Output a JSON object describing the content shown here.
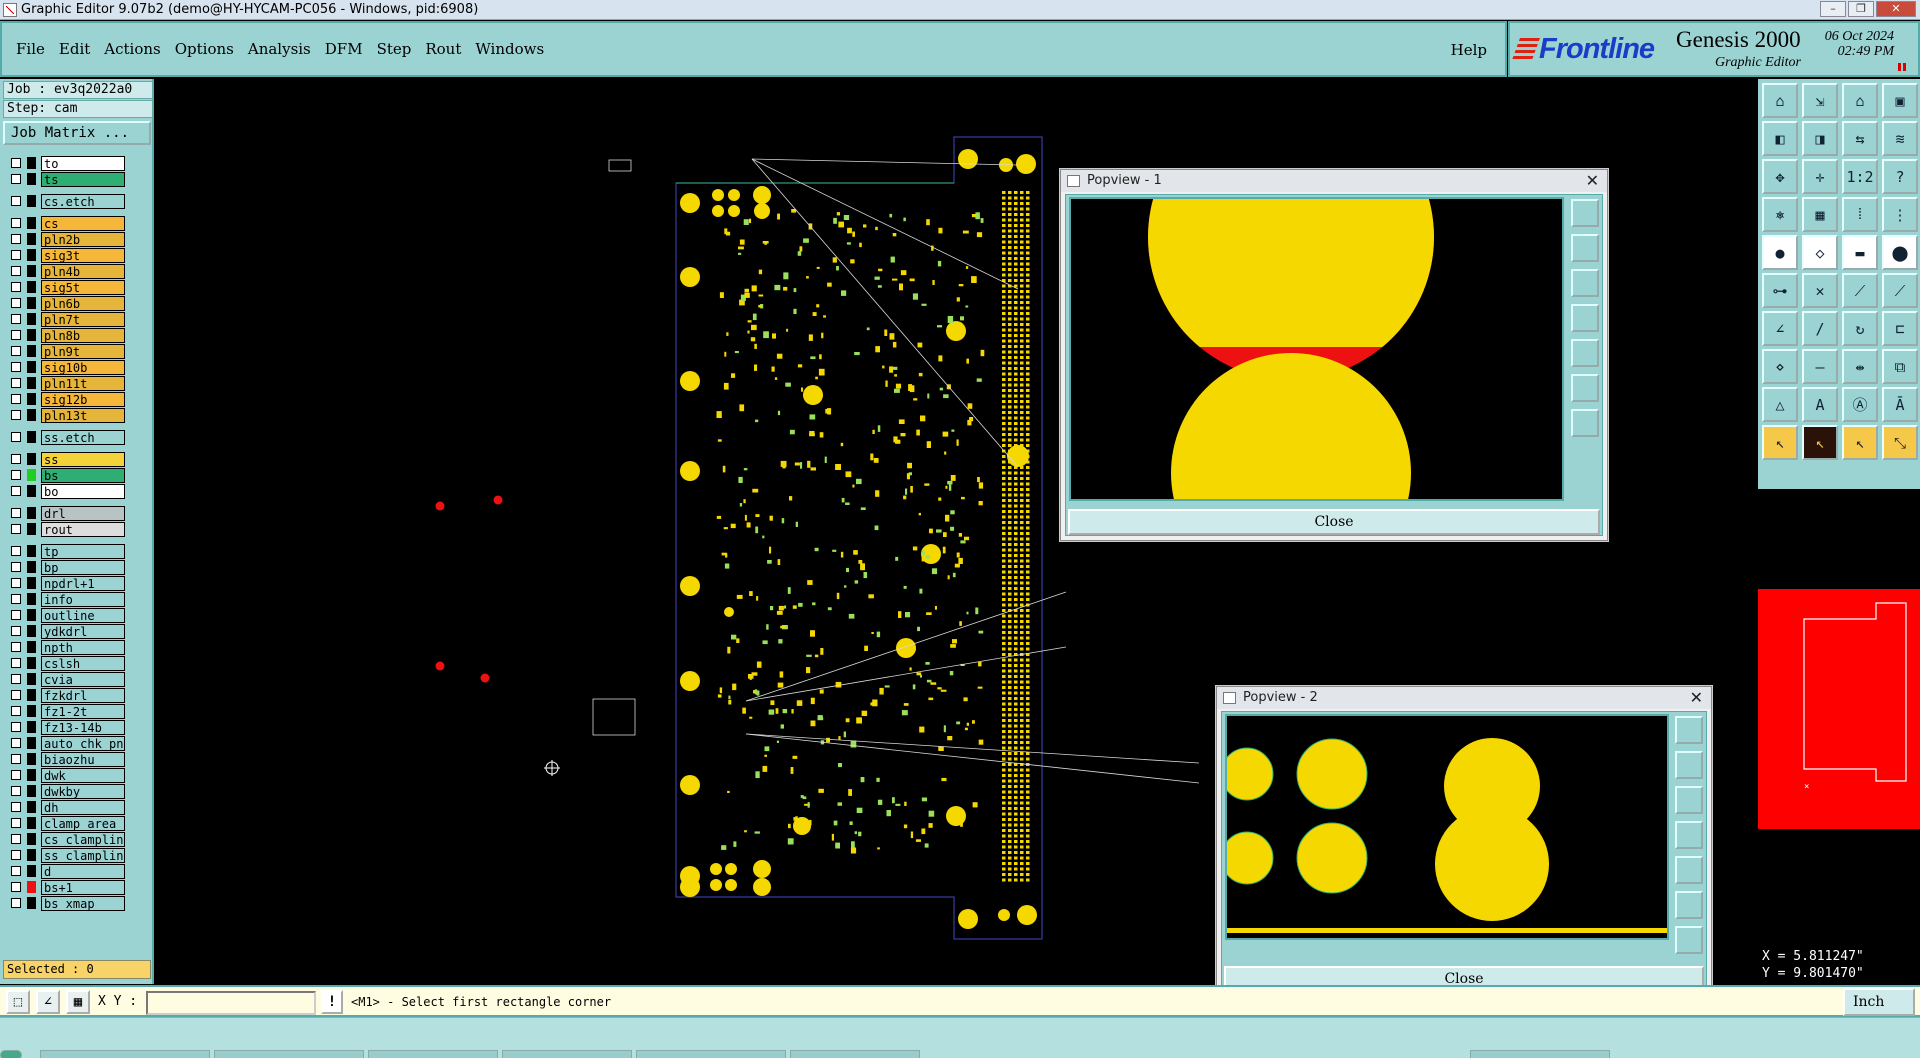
{
  "window": {
    "title": "Graphic Editor 9.07b2 (demo@HY-HYCAM-PC056 - Windows, pid:6908)",
    "controls": [
      "–",
      "❐",
      "✕"
    ]
  },
  "menu": {
    "items": [
      "File",
      "Edit",
      "Actions",
      "Options",
      "Analysis",
      "DFM",
      "Step",
      "Rout",
      "Windows"
    ],
    "help": "Help"
  },
  "brand": {
    "logo_text": "Frontline",
    "product": "Genesis 2000",
    "subtitle": "Graphic Editor",
    "date": "06 Oct 2024",
    "time": "02:49 PM"
  },
  "job": {
    "job_line": "Job : ev3q2022a0",
    "step_line": "Step: cam",
    "job_matrix_button": "Job Matrix ..."
  },
  "layers": [
    {
      "name": "to",
      "bg": "#ffffff",
      "swatch": "#000000"
    },
    {
      "name": "ts",
      "bg": "#2fae74",
      "swatch": "#000000",
      "gap_after": true
    },
    {
      "name": "cs.etch",
      "bg": "#9bd3d3",
      "swatch": "#000000",
      "gap_after": true
    },
    {
      "name": "cs",
      "bg": "#f4b73a",
      "swatch": "#000000"
    },
    {
      "name": "pln2b",
      "bg": "#e5b43a",
      "swatch": "#000000"
    },
    {
      "name": "sig3t",
      "bg": "#f4b73a",
      "swatch": "#000000"
    },
    {
      "name": "pln4b",
      "bg": "#e5b43a",
      "swatch": "#000000"
    },
    {
      "name": "sig5t",
      "bg": "#f4b73a",
      "swatch": "#000000"
    },
    {
      "name": "pln6b",
      "bg": "#e5b43a",
      "swatch": "#000000"
    },
    {
      "name": "pln7t",
      "bg": "#e5b43a",
      "swatch": "#000000"
    },
    {
      "name": "pln8b",
      "bg": "#e5b43a",
      "swatch": "#000000"
    },
    {
      "name": "pln9t",
      "bg": "#e5b43a",
      "swatch": "#000000"
    },
    {
      "name": "sig10b",
      "bg": "#f4b73a",
      "swatch": "#000000"
    },
    {
      "name": "pln11t",
      "bg": "#e5b43a",
      "swatch": "#000000"
    },
    {
      "name": "sig12b",
      "bg": "#f4b73a",
      "swatch": "#000000"
    },
    {
      "name": "pln13t",
      "bg": "#e5b43a",
      "swatch": "#000000",
      "gap_after": true
    },
    {
      "name": "ss.etch",
      "bg": "#9bd3d3",
      "swatch": "#000000",
      "gap_after": true
    },
    {
      "name": "ss",
      "bg": "#f4d23a",
      "swatch": "#000000"
    },
    {
      "name": "bs",
      "bg": "#2fae74",
      "swatch": "#22cc22"
    },
    {
      "name": "bo",
      "bg": "#ffffff",
      "swatch": "#000000",
      "gap_after": true
    },
    {
      "name": "drl",
      "bg": "#b8c4c4",
      "swatch": "#000000"
    },
    {
      "name": "rout",
      "bg": "#dddddd",
      "swatch": "#000000",
      "gap_after": true
    },
    {
      "name": "tp",
      "bg": "#9bd3d3",
      "swatch": "#000000"
    },
    {
      "name": "bp",
      "bg": "#9bd3d3",
      "swatch": "#000000"
    },
    {
      "name": "npdrl+1",
      "bg": "#9bd3d3",
      "swatch": "#000000"
    },
    {
      "name": "info",
      "bg": "#9bd3d3",
      "swatch": "#000000"
    },
    {
      "name": "outline",
      "bg": "#9bd3d3",
      "swatch": "#000000"
    },
    {
      "name": "ydkdrl",
      "bg": "#9bd3d3",
      "swatch": "#000000"
    },
    {
      "name": "npth",
      "bg": "#9bd3d3",
      "swatch": "#000000"
    },
    {
      "name": "cslsh",
      "bg": "#9bd3d3",
      "swatch": "#000000"
    },
    {
      "name": "cvia",
      "bg": "#9bd3d3",
      "swatch": "#000000"
    },
    {
      "name": "fzkdrl",
      "bg": "#9bd3d3",
      "swatch": "#000000"
    },
    {
      "name": "fz1-2t",
      "bg": "#9bd3d3",
      "swatch": "#000000"
    },
    {
      "name": "fz13-14b",
      "bg": "#9bd3d3",
      "swatch": "#000000"
    },
    {
      "name": "auto_chk_pn",
      "bg": "#9bd3d3",
      "swatch": "#000000"
    },
    {
      "name": "biaozhu",
      "bg": "#9bd3d3",
      "swatch": "#000000"
    },
    {
      "name": "dwk",
      "bg": "#9bd3d3",
      "swatch": "#000000"
    },
    {
      "name": "dwkby",
      "bg": "#9bd3d3",
      "swatch": "#000000"
    },
    {
      "name": "dh",
      "bg": "#9bd3d3",
      "swatch": "#000000"
    },
    {
      "name": "clamp_area",
      "bg": "#9bd3d3",
      "swatch": "#000000"
    },
    {
      "name": "cs_clampline",
      "bg": "#9bd3d3",
      "swatch": "#000000"
    },
    {
      "name": "ss_clampline",
      "bg": "#9bd3d3",
      "swatch": "#000000"
    },
    {
      "name": "d",
      "bg": "#9bd3d3",
      "swatch": "#000000"
    },
    {
      "name": "bs+1",
      "bg": "#9bd3d3",
      "swatch": "#ee1111"
    },
    {
      "name": "bs_xmap",
      "bg": "#9bd3d3",
      "swatch": "#000000"
    }
  ],
  "selected_text": "Selected : 0",
  "popview1": {
    "title": "Popview - 1",
    "close_label": "Close"
  },
  "popview2": {
    "title": "Popview - 2",
    "close_label": "Close"
  },
  "coords": {
    "x": "X = 5.811247\"",
    "y": "Y = 9.801470\""
  },
  "status": {
    "xy_label": "X Y :",
    "xy_value": "",
    "prompt": "<M1> - Select first rectangle corner",
    "unit": "Inch"
  },
  "colors": {
    "panel": "#9bd3d3",
    "pad": "#f5d800",
    "drill": "#ee1111",
    "outline": "#3a3aa0"
  }
}
